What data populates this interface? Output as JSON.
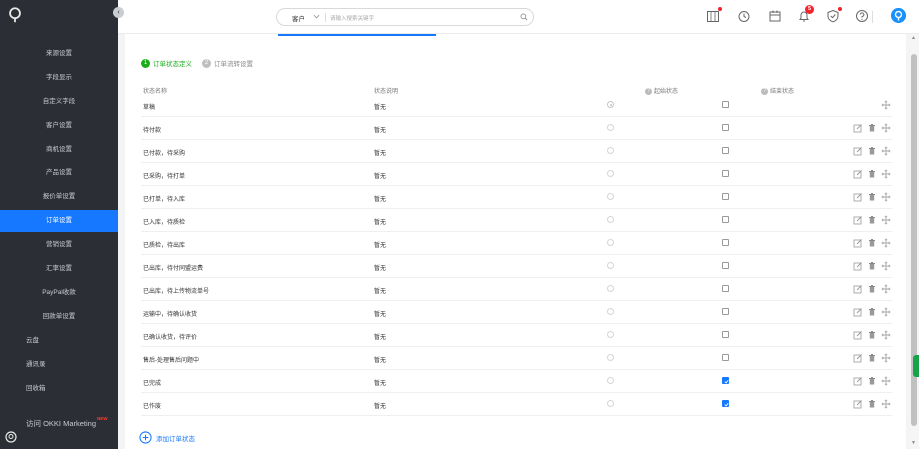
{
  "sidebar": {
    "items": [
      {
        "label": "来源设置",
        "level": "sub",
        "active": false
      },
      {
        "label": "字段显示",
        "level": "sub",
        "active": false
      },
      {
        "label": "自定义字段",
        "level": "sub",
        "active": false
      },
      {
        "label": "客户设置",
        "level": "sub",
        "active": false
      },
      {
        "label": "商机设置",
        "level": "sub",
        "active": false
      },
      {
        "label": "产品设置",
        "level": "sub",
        "active": false
      },
      {
        "label": "报价单设置",
        "level": "sub",
        "active": false
      },
      {
        "label": "订单设置",
        "level": "sub",
        "active": true
      },
      {
        "label": "营销设置",
        "level": "sub",
        "active": false
      },
      {
        "label": "汇率设置",
        "level": "sub",
        "active": false
      },
      {
        "label": "PayPal收款",
        "level": "sub",
        "active": false
      },
      {
        "label": "回款单设置",
        "level": "sub",
        "active": false
      },
      {
        "label": "云盘",
        "level": "top",
        "active": false
      },
      {
        "label": "通讯录",
        "level": "top",
        "active": false
      },
      {
        "label": "回收箱",
        "level": "top",
        "active": false
      }
    ],
    "visit_label": "访问 OKKI Marketing",
    "new_badge": "NEW"
  },
  "topbar": {
    "search_type": "客户",
    "search_placeholder": "请输入搜索关键字",
    "notification_count": "5"
  },
  "steps": [
    {
      "number": "1",
      "label": "订单状态定义",
      "active": true
    },
    {
      "number": "2",
      "label": "订单流转设置",
      "active": false
    }
  ],
  "table": {
    "headers": {
      "name": "状态名称",
      "desc": "状态说明",
      "start": "起始状态",
      "end": "结束状态"
    },
    "rows": [
      {
        "name": "草稿",
        "desc": "暂无",
        "start": true,
        "end": false,
        "editable": false
      },
      {
        "name": "待付款",
        "desc": "暂无",
        "start": false,
        "end": false,
        "editable": true
      },
      {
        "name": "已付款，待采购",
        "desc": "暂无",
        "start": false,
        "end": false,
        "editable": true
      },
      {
        "name": "已采购，待打单",
        "desc": "暂无",
        "start": false,
        "end": false,
        "editable": true
      },
      {
        "name": "已打单，待入库",
        "desc": "暂无",
        "start": false,
        "end": false,
        "editable": true
      },
      {
        "name": "已入库，待质检",
        "desc": "暂无",
        "start": false,
        "end": false,
        "editable": true
      },
      {
        "name": "已质检，待出库",
        "desc": "暂无",
        "start": false,
        "end": false,
        "editable": true
      },
      {
        "name": "已出库，待付同盟运费",
        "desc": "暂无",
        "start": false,
        "end": false,
        "editable": true
      },
      {
        "name": "已出库，待上传物流单号",
        "desc": "暂无",
        "start": false,
        "end": false,
        "editable": true
      },
      {
        "name": "运输中，待确认收货",
        "desc": "暂无",
        "start": false,
        "end": false,
        "editable": true
      },
      {
        "name": "已确认收货，待评价",
        "desc": "暂无",
        "start": false,
        "end": false,
        "editable": true
      },
      {
        "name": "售后-处理售后问题中",
        "desc": "暂无",
        "start": false,
        "end": false,
        "editable": true
      },
      {
        "name": "已完成",
        "desc": "暂无",
        "start": false,
        "end": true,
        "editable": true
      },
      {
        "name": "已作废",
        "desc": "暂无",
        "start": false,
        "end": true,
        "editable": true
      }
    ]
  },
  "add_status_label": "添加订单状态",
  "colors": {
    "sidebar_bg": "#2b2f35",
    "accent": "#1677ff",
    "step_active": "#1aad19",
    "step_inactive": "#bfbfbf",
    "badge_red": "#f5222d"
  }
}
